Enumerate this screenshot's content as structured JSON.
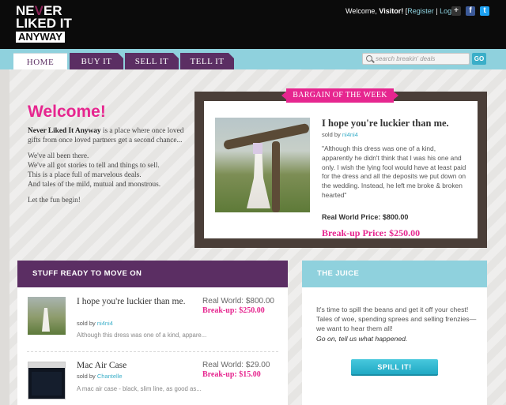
{
  "colors": {
    "header_bg": "#0b0b0b",
    "nav_bg": "#8fd1dd",
    "tab_purple": "#5b2e63",
    "accent_pink": "#e6268f",
    "accent_teal": "#3aaec8"
  },
  "header": {
    "logo": {
      "line1_a": "NE",
      "line1_v": "V",
      "line1_b": "ER",
      "line2": "LIKED IT",
      "line3": "ANYWAY"
    },
    "welcome_prefix": "Welcome, ",
    "visitor": "Visitor!",
    "bracket_open": " [",
    "register": "Register",
    "separator": " | ",
    "login": "Login",
    "bracket_close": " ]",
    "icons": [
      "plus-icon",
      "facebook-icon",
      "twitter-icon"
    ],
    "icon_glyphs": {
      "plus": "+",
      "facebook": "f",
      "twitter": "t"
    }
  },
  "nav": {
    "tabs": [
      {
        "label": "HOME",
        "active": true
      },
      {
        "label": "BUY IT",
        "active": false
      },
      {
        "label": "SELL IT",
        "active": false
      },
      {
        "label": "TELL IT",
        "active": false
      }
    ],
    "search": {
      "placeholder": "search breakin' deals",
      "button": "GO"
    }
  },
  "welcome": {
    "title": "Welcome!",
    "intro_bold": "Never Liked It Anyway",
    "intro_rest": " is a place where once loved gifts from once loved partners get a second chance...",
    "para2_lines": [
      "We've all been there.",
      "We've all got stories to tell and things to sell.",
      "This is a place full of marvelous deals.",
      "And tales of the mild, mutual and monstrous."
    ],
    "closing": "Let the fun begin!"
  },
  "bargain": {
    "ribbon": "BARGAIN OF THE WEEK",
    "title": "I hope you're luckier than me.",
    "sold_by_label": "sold by ",
    "seller": "ni4ni4",
    "quote": "\"Although this dress was one of a kind, apparently he didn't think that I was his one and only. I wish the lying fool would have at least paid for the dress and all the deposits we put down on the wedding. Instead, he left me broke & broken hearted\"",
    "real_world_price": "Real World Price: $800.00",
    "breakup_price": "Break-up Price: $250.00"
  },
  "stuff": {
    "header": "STUFF READY TO MOVE ON",
    "items": [
      {
        "title": "I hope you're luckier than me.",
        "sold_by_label": "sold by ",
        "seller": "ni4ni4",
        "desc": "Although this dress was one of a kind, appare...",
        "real_world": "Real World: $800.00",
        "breakup": "Break-up: $250.00"
      },
      {
        "title": "Mac Air Case",
        "sold_by_label": "sold by ",
        "seller": "Chantelle",
        "desc": "A mac air case - black, slim line, as good as...",
        "real_world": "Real World: $29.00",
        "breakup": "Break-up: $15.00"
      }
    ]
  },
  "juice": {
    "header": "THE JUICE",
    "text": "It's time to spill the beans and get it off your chest! Tales of woe, spending sprees and selling frenzies—we want to hear them all!",
    "cta": "Go on, tell us what happened.",
    "button": "SPILL IT!"
  }
}
